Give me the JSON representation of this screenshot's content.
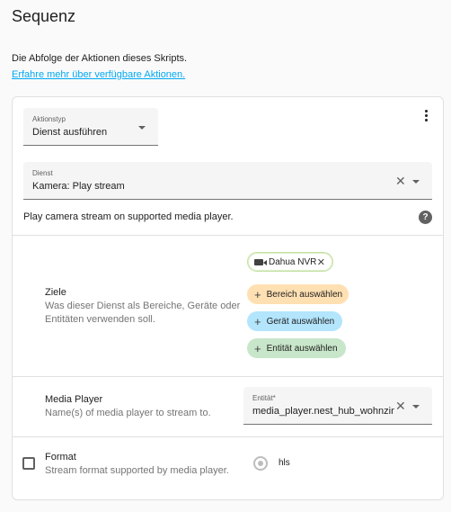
{
  "header": {
    "title": "Sequenz",
    "description": "Die Abfolge der Aktionen dieses Skripts.",
    "learn_more": "Erfahre mehr über verfügbare Aktionen."
  },
  "action": {
    "type_label": "Aktionstyp",
    "type_value": "Dienst ausführen",
    "service_label": "Dienst",
    "service_value": "Kamera: Play stream",
    "service_description": "Play camera stream on supported media player.",
    "help_glyph": "?"
  },
  "targets": {
    "title": "Ziele",
    "description": "Was dieser Dienst als Bereiche, Geräte oder Entitäten verwenden soll.",
    "device_chip": "Dahua NVR",
    "add_area": "Bereich auswählen",
    "add_device": "Gerät auswählen",
    "add_entity": "Entität auswählen"
  },
  "media_player": {
    "title": "Media Player",
    "description": "Name(s) of media player to stream to.",
    "entity_label": "Entität*",
    "entity_value": "media_player.nest_hub_wohnzim"
  },
  "format": {
    "title": "Format",
    "description": "Stream format supported by media player.",
    "option": "hls"
  },
  "colors": {
    "link": "#03a9f4",
    "area_chip": "#ffe0b2",
    "device_chip": "#b3e5fc",
    "entity_chip": "#c8e6c9"
  }
}
